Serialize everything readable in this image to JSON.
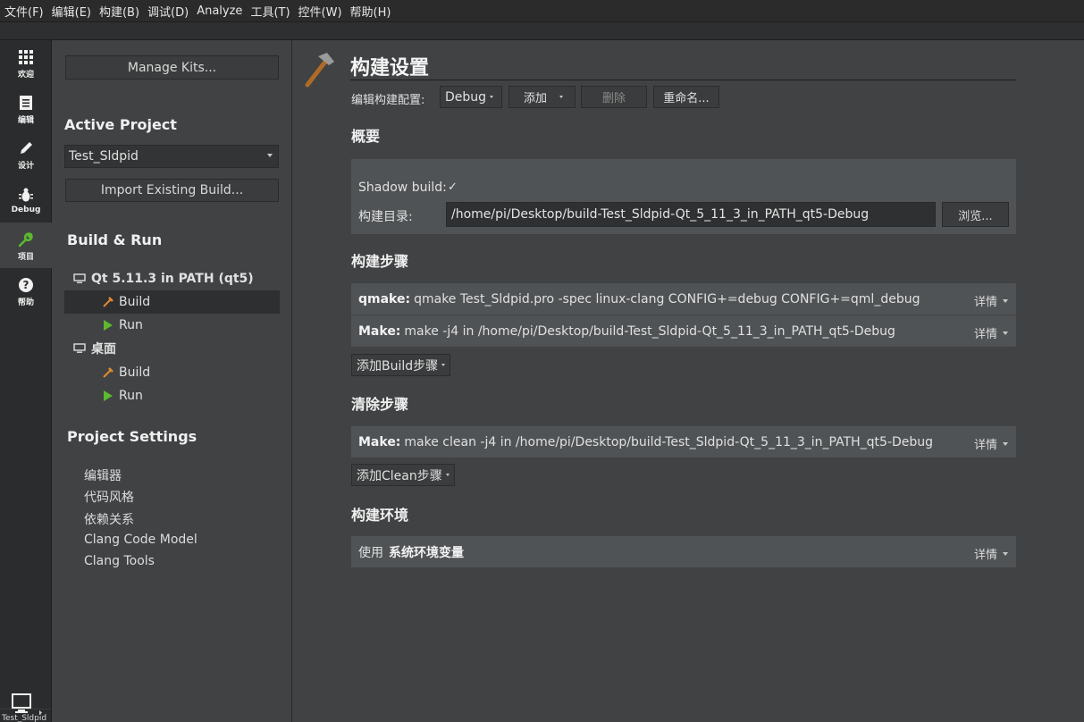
{
  "menu": [
    {
      "label": "文件(F)"
    },
    {
      "label": "编辑(E)"
    },
    {
      "label": "构建(B)"
    },
    {
      "label": "调试(D)"
    },
    {
      "label": "Analyze"
    },
    {
      "label": "工具(T)"
    },
    {
      "label": "控件(W)"
    },
    {
      "label": "帮助(H)"
    }
  ],
  "modes": [
    {
      "label": "欢迎",
      "icon": "grid-icon"
    },
    {
      "label": "编辑",
      "icon": "document-icon"
    },
    {
      "label": "设计",
      "icon": "pencil-icon"
    },
    {
      "label": "Debug",
      "icon": "bug-icon"
    },
    {
      "label": "项目",
      "icon": "wrench-icon"
    },
    {
      "label": "帮助",
      "icon": "help-icon"
    }
  ],
  "kit_selector": {
    "project": "Test_Sldpid",
    "icon": "monitor-icon"
  },
  "nav": {
    "manage_kits": "Manage Kits...",
    "active_project_heading": "Active Project",
    "active_project_value": "Test_Sldpid",
    "import_build": "Import Existing Build...",
    "build_run_heading": "Build & Run",
    "tree": [
      {
        "label": "Qt 5.11.3 in PATH (qt5)",
        "kind": "kit"
      },
      {
        "label": "Build",
        "kind": "build",
        "selected": true
      },
      {
        "label": "Run",
        "kind": "run"
      },
      {
        "label": "桌面",
        "kind": "kit"
      },
      {
        "label": "Build",
        "kind": "build"
      },
      {
        "label": "Run",
        "kind": "run"
      }
    ],
    "project_settings_heading": "Project Settings",
    "settings": [
      "编辑器",
      "代码风格",
      "依赖关系",
      "Clang Code Model",
      "Clang Tools"
    ]
  },
  "main": {
    "title": "构建设置",
    "config_label": "编辑构建配置:",
    "config_value": "Debug",
    "add_label": "添加",
    "delete_label": "删除",
    "rename_label": "重命名...",
    "overview_heading": "概要",
    "shadow_build_label": "Shadow build:",
    "shadow_build_checked": "✓",
    "build_dir_label": "构建目录:",
    "build_dir_value": "/home/pi/Desktop/build-Test_Sldpid-Qt_5_11_3_in_PATH_qt5-Debug",
    "browse_label": "浏览...",
    "build_steps_heading": "构建步骤",
    "build_steps": [
      {
        "name": "qmake:",
        "text": "qmake Test_Sldpid.pro -spec linux-clang CONFIG+=debug CONFIG+=qml_debug",
        "details": "详情"
      },
      {
        "name": "Make:",
        "text": "make -j4 in /home/pi/Desktop/build-Test_Sldpid-Qt_5_11_3_in_PATH_qt5-Debug",
        "details": "详情"
      }
    ],
    "add_build_step": "添加Build步骤",
    "clean_steps_heading": "清除步骤",
    "clean_steps": [
      {
        "name": "Make:",
        "text": "make clean -j4 in /home/pi/Desktop/build-Test_Sldpid-Qt_5_11_3_in_PATH_qt5-Debug",
        "details": "详情"
      }
    ],
    "add_clean_step": "添加Clean步骤",
    "env_heading": "构建环境",
    "env_use": "使用",
    "env_value": "系统环境变量",
    "env_details": "详情"
  },
  "colors": {
    "accent_green": "#5cb82e",
    "hammer_orange": "#e08a30",
    "background": "#404244"
  }
}
